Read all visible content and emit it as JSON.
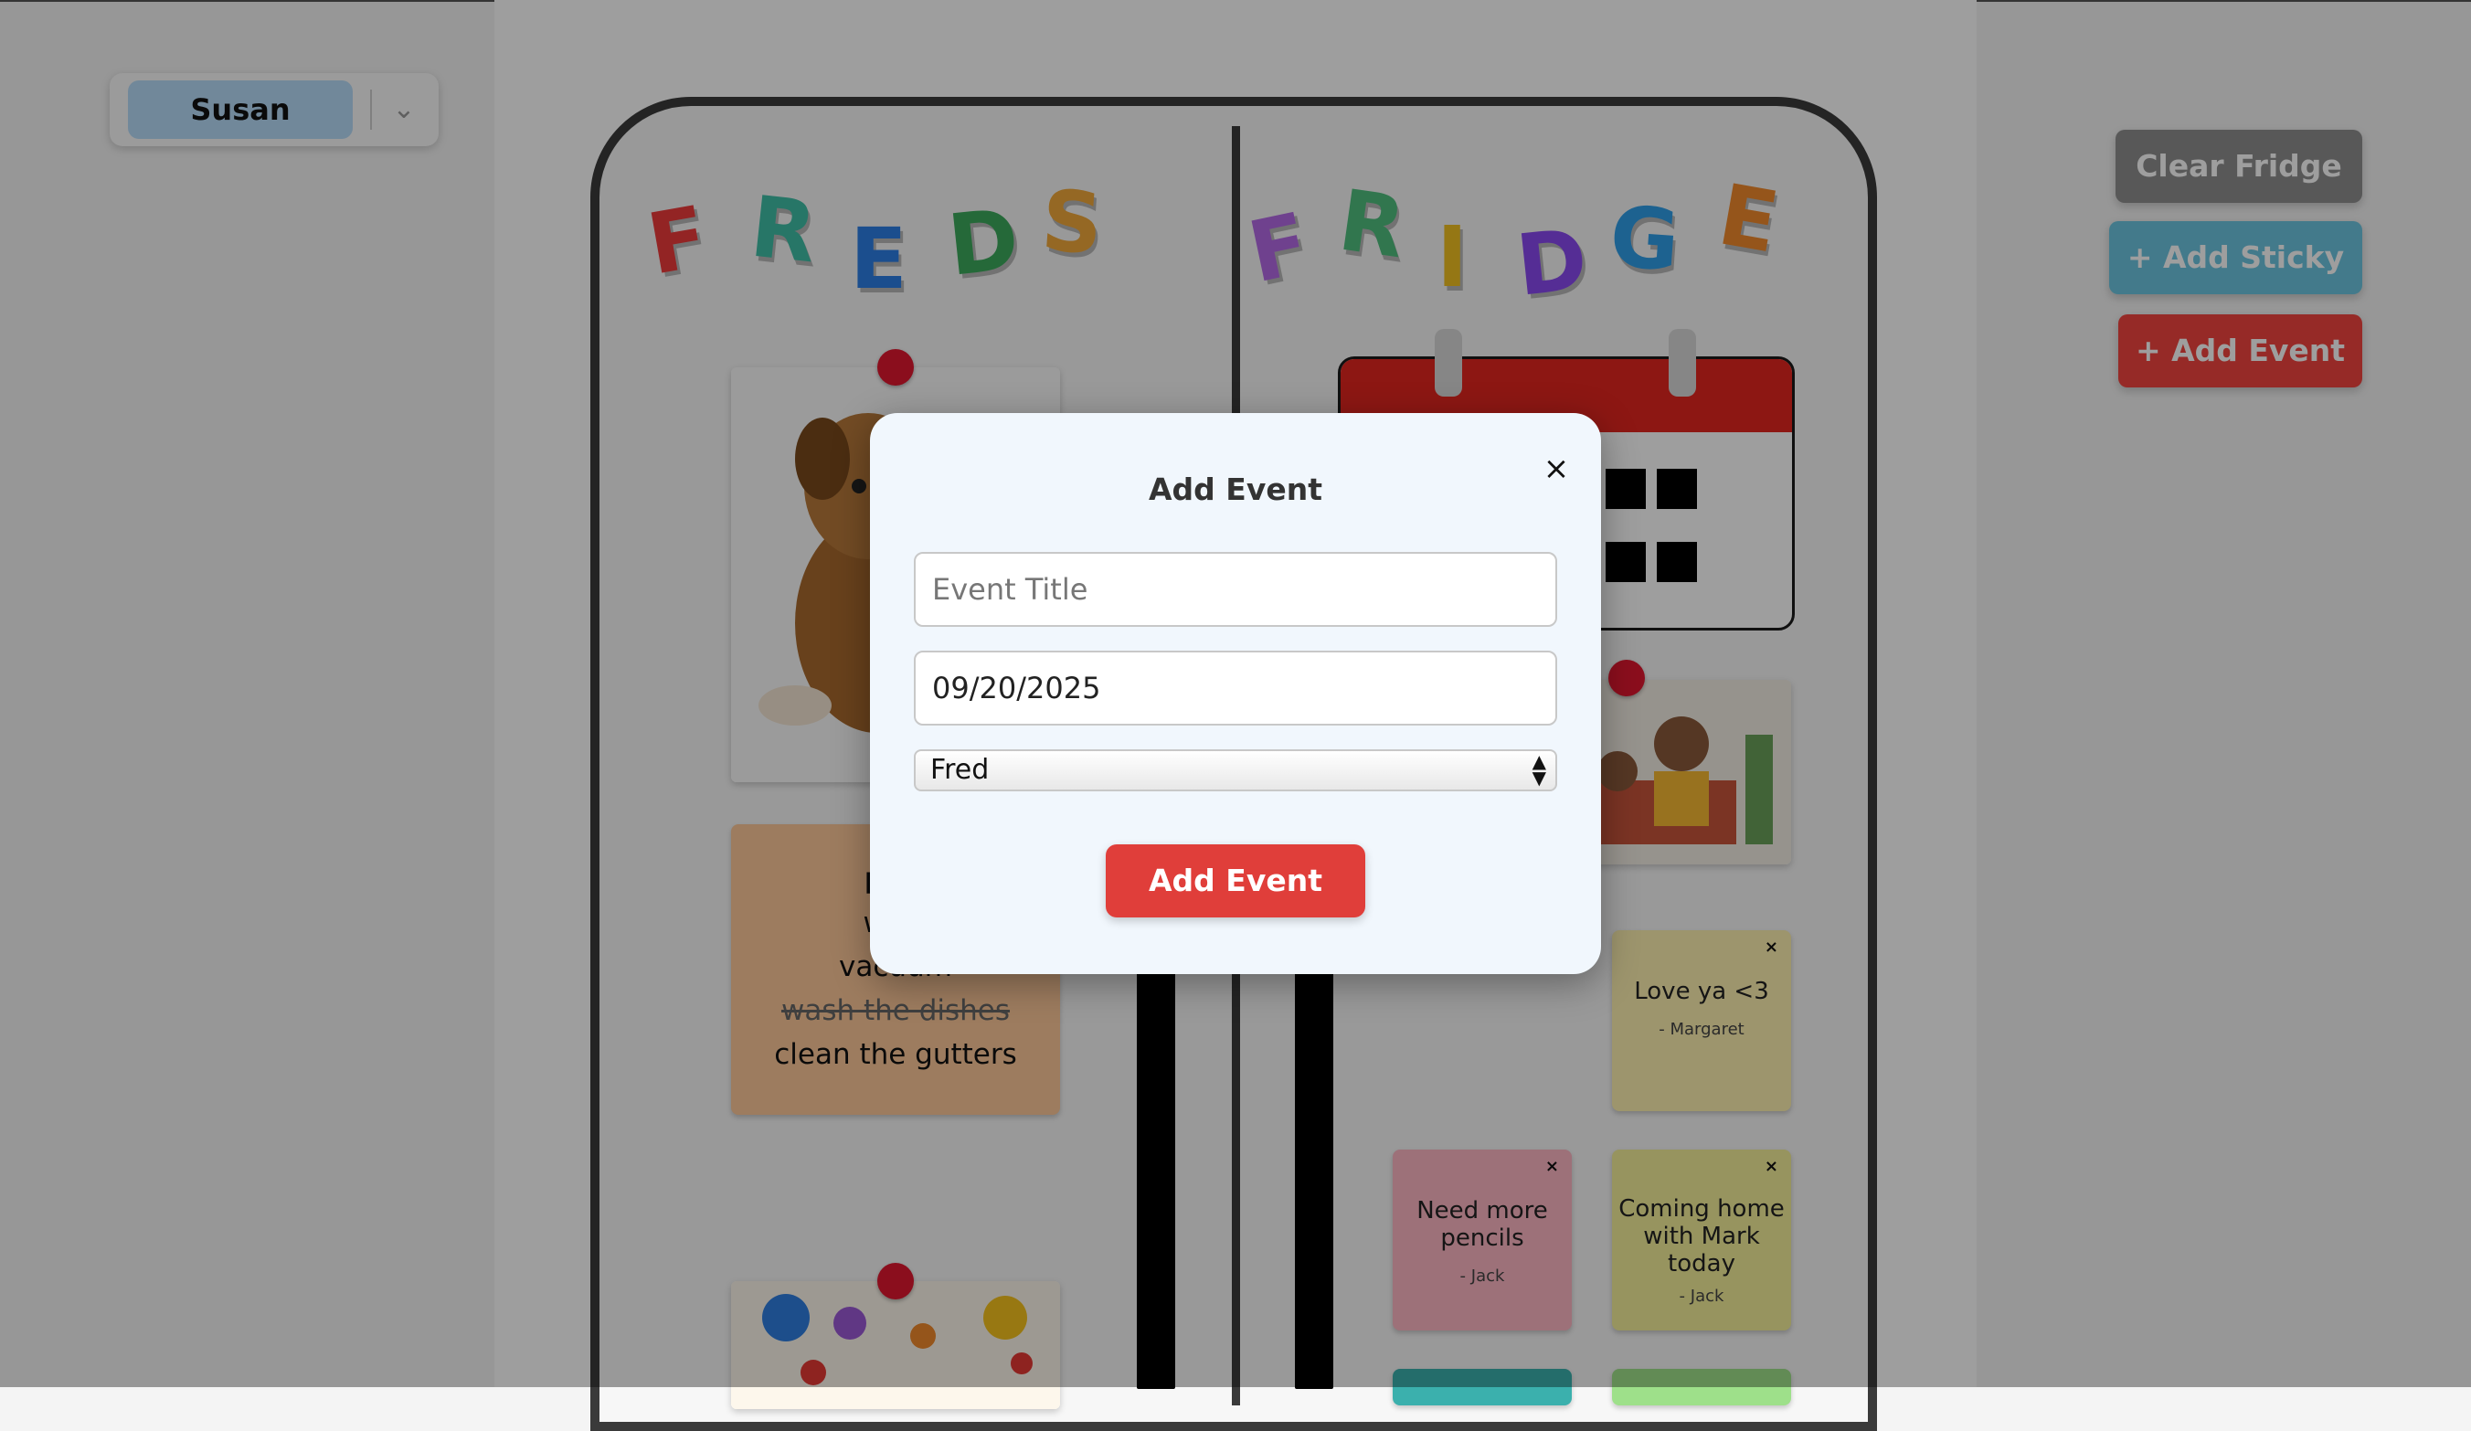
{
  "user_selector": {
    "selected": "Susan"
  },
  "title_letters": {
    "left": [
      "F",
      "R",
      "E",
      "D",
      "S"
    ],
    "right": [
      "F",
      "R",
      "I",
      "D",
      "G",
      "E"
    ],
    "colors": {
      "F1": "#ee3b3b",
      "R1": "#3fbfa6",
      "E1": "#2d7fe6",
      "D1": "#3caa5c",
      "S1": "#f1a83a",
      "F2": "#b469e6",
      "R2": "#4fbf7f",
      "I2": "#f0c021",
      "D2": "#8a4af0",
      "G2": "#2f9ee8",
      "E2": "#f08a2c"
    }
  },
  "actions": {
    "clear_label": "Clear Fridge",
    "add_sticky_label": "+ Add Sticky",
    "add_event_label": "+ Add Event"
  },
  "todo": {
    "title": "Ren",
    "items": [
      {
        "text": "walk",
        "done": false
      },
      {
        "text": "vacuum",
        "done": false
      },
      {
        "text": "wash the dishes",
        "done": true
      },
      {
        "text": "clean the gutters",
        "done": false
      }
    ]
  },
  "stickies": [
    {
      "message": "Love ya <3",
      "author": "- Margaret",
      "color": "#fef0b0"
    },
    {
      "message": "Need more pencils",
      "author": "- Jack",
      "color": "#fdb6c3"
    },
    {
      "message": "Coming home with Mark today",
      "author": "- Jack",
      "color": "#f4ef9a"
    }
  ],
  "modal": {
    "title": "Add Event",
    "close_icon": "×",
    "title_placeholder": "Event Title",
    "date_value": "09/20/2025",
    "person_selected": "Fred",
    "submit_label": "Add Event"
  }
}
